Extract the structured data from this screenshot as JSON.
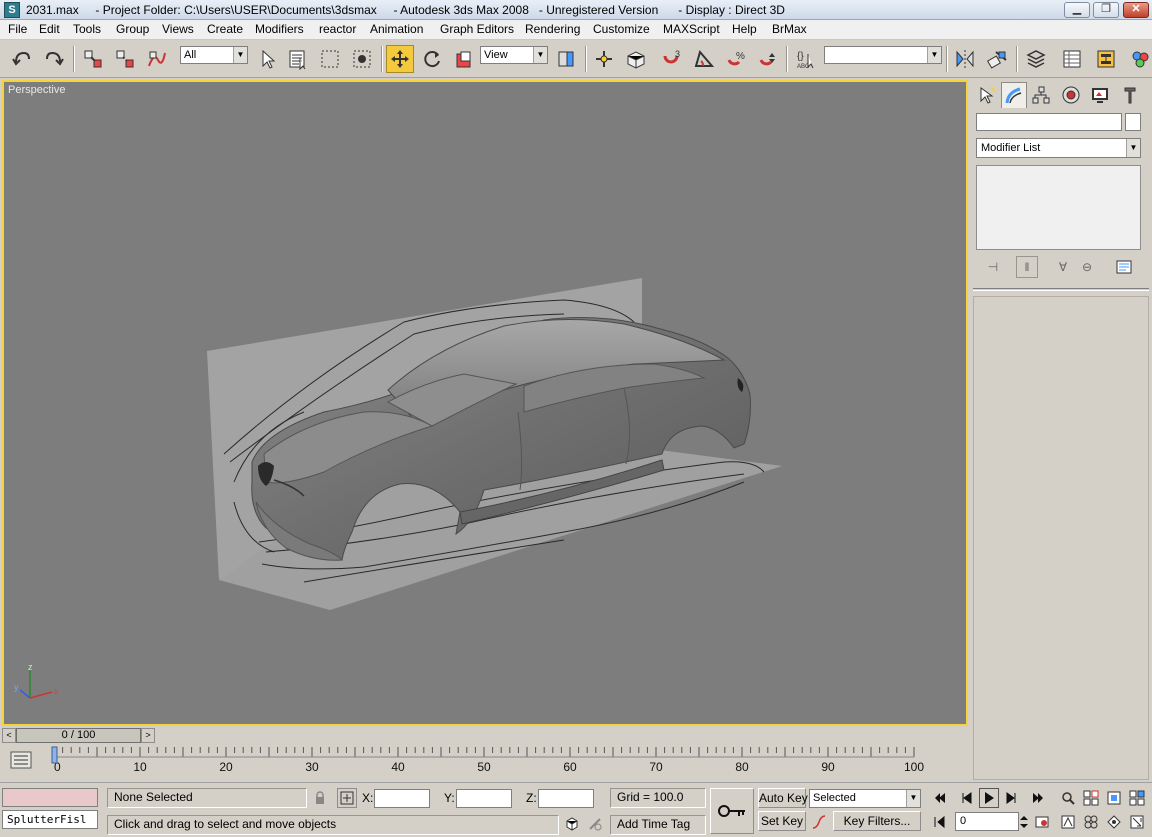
{
  "titlebar": {
    "text": "2031.max     - Project Folder: C:\\Users\\USER\\Documents\\3dsmax     - Autodesk 3ds Max 2008   - Unregistered Version      - Display : Direct 3D",
    "buttons": [
      "minimize",
      "maximize",
      "close"
    ]
  },
  "menu": [
    "File",
    "Edit",
    "Tools",
    "Group",
    "Views",
    "Create",
    "Modifiers",
    "reactor",
    "Animation",
    "Graph Editors",
    "Rendering",
    "Customize",
    "MAXScript",
    "Help",
    "BrMax"
  ],
  "toolbar": {
    "selection_filter": "All",
    "reference_coord": "View",
    "snap_3": "3",
    "named_selection": ""
  },
  "viewport": {
    "label": "Perspective",
    "axis": {
      "z": "z",
      "x": "x",
      "y": "y"
    },
    "active_color": "#f3d43c"
  },
  "command_panel": {
    "name_value": "",
    "modifier_list": "Modifier List"
  },
  "time_slider": {
    "position": "0 / 100",
    "current_frame": 0,
    "total_frames": 100
  },
  "track": {
    "labels": [
      "0",
      "10",
      "20",
      "30",
      "40",
      "50",
      "60",
      "70",
      "80",
      "90",
      "100"
    ]
  },
  "status": {
    "script_listener": "SplutterFisl",
    "selection": "None Selected",
    "prompt": "Click and drag to select and move objects",
    "x_label": "X:",
    "y_label": "Y:",
    "z_label": "Z:",
    "x_value": "",
    "y_value": "",
    "z_value": "",
    "grid": "Grid = 100.0",
    "add_time_tag": "Add Time Tag",
    "auto_key": "Auto Key",
    "set_key": "Set Key",
    "key_mode": "Selected",
    "key_filters": "Key Filters...",
    "frame_value": "0"
  }
}
